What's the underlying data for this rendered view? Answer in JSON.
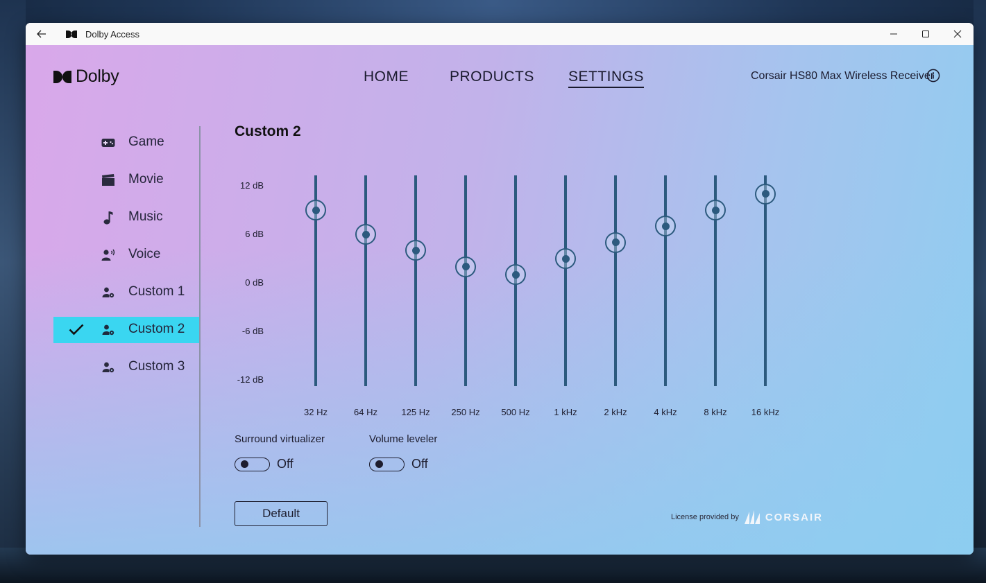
{
  "window": {
    "title": "Dolby Access"
  },
  "brand": {
    "name": "Dolby"
  },
  "nav": {
    "items": [
      {
        "label": "HOME",
        "active": false
      },
      {
        "label": "PRODUCTS",
        "active": false
      },
      {
        "label": "SETTINGS",
        "active": true
      }
    ],
    "device": "Corsair HS80 Max Wireless Receiver"
  },
  "sidebar": {
    "items": [
      {
        "label": "Game",
        "icon": "gamepad-icon",
        "active": false
      },
      {
        "label": "Movie",
        "icon": "clapperboard-icon",
        "active": false
      },
      {
        "label": "Music",
        "icon": "music-note-icon",
        "active": false
      },
      {
        "label": "Voice",
        "icon": "voice-icon",
        "active": false
      },
      {
        "label": "Custom 1",
        "icon": "user-gear-icon",
        "active": false
      },
      {
        "label": "Custom 2",
        "icon": "user-gear-icon",
        "active": true
      },
      {
        "label": "Custom 3",
        "icon": "user-gear-icon",
        "active": false
      }
    ]
  },
  "preset": {
    "title": "Custom 2"
  },
  "equalizer": {
    "db_labels": [
      "12 dB",
      "6 dB",
      "0 dB",
      "-6 dB",
      "-12 dB"
    ],
    "range_db": [
      -12,
      12
    ],
    "bands": [
      {
        "freq": "32 Hz",
        "gain_db": 9
      },
      {
        "freq": "64 Hz",
        "gain_db": 6
      },
      {
        "freq": "125 Hz",
        "gain_db": 4
      },
      {
        "freq": "250 Hz",
        "gain_db": 2
      },
      {
        "freq": "500 Hz",
        "gain_db": 1
      },
      {
        "freq": "1 kHz",
        "gain_db": 3
      },
      {
        "freq": "2 kHz",
        "gain_db": 5
      },
      {
        "freq": "4 kHz",
        "gain_db": 7
      },
      {
        "freq": "8 kHz",
        "gain_db": 9
      },
      {
        "freq": "16 kHz",
        "gain_db": 11
      }
    ]
  },
  "settings": {
    "surround": {
      "label": "Surround virtualizer",
      "state": "Off"
    },
    "leveler": {
      "label": "Volume leveler",
      "state": "Off"
    }
  },
  "default_button": "Default",
  "license": {
    "text": "License provided by",
    "brand": "CORSAIR"
  },
  "colors": {
    "accent": "#3ad6f1",
    "slider": "#2c5a7e"
  }
}
